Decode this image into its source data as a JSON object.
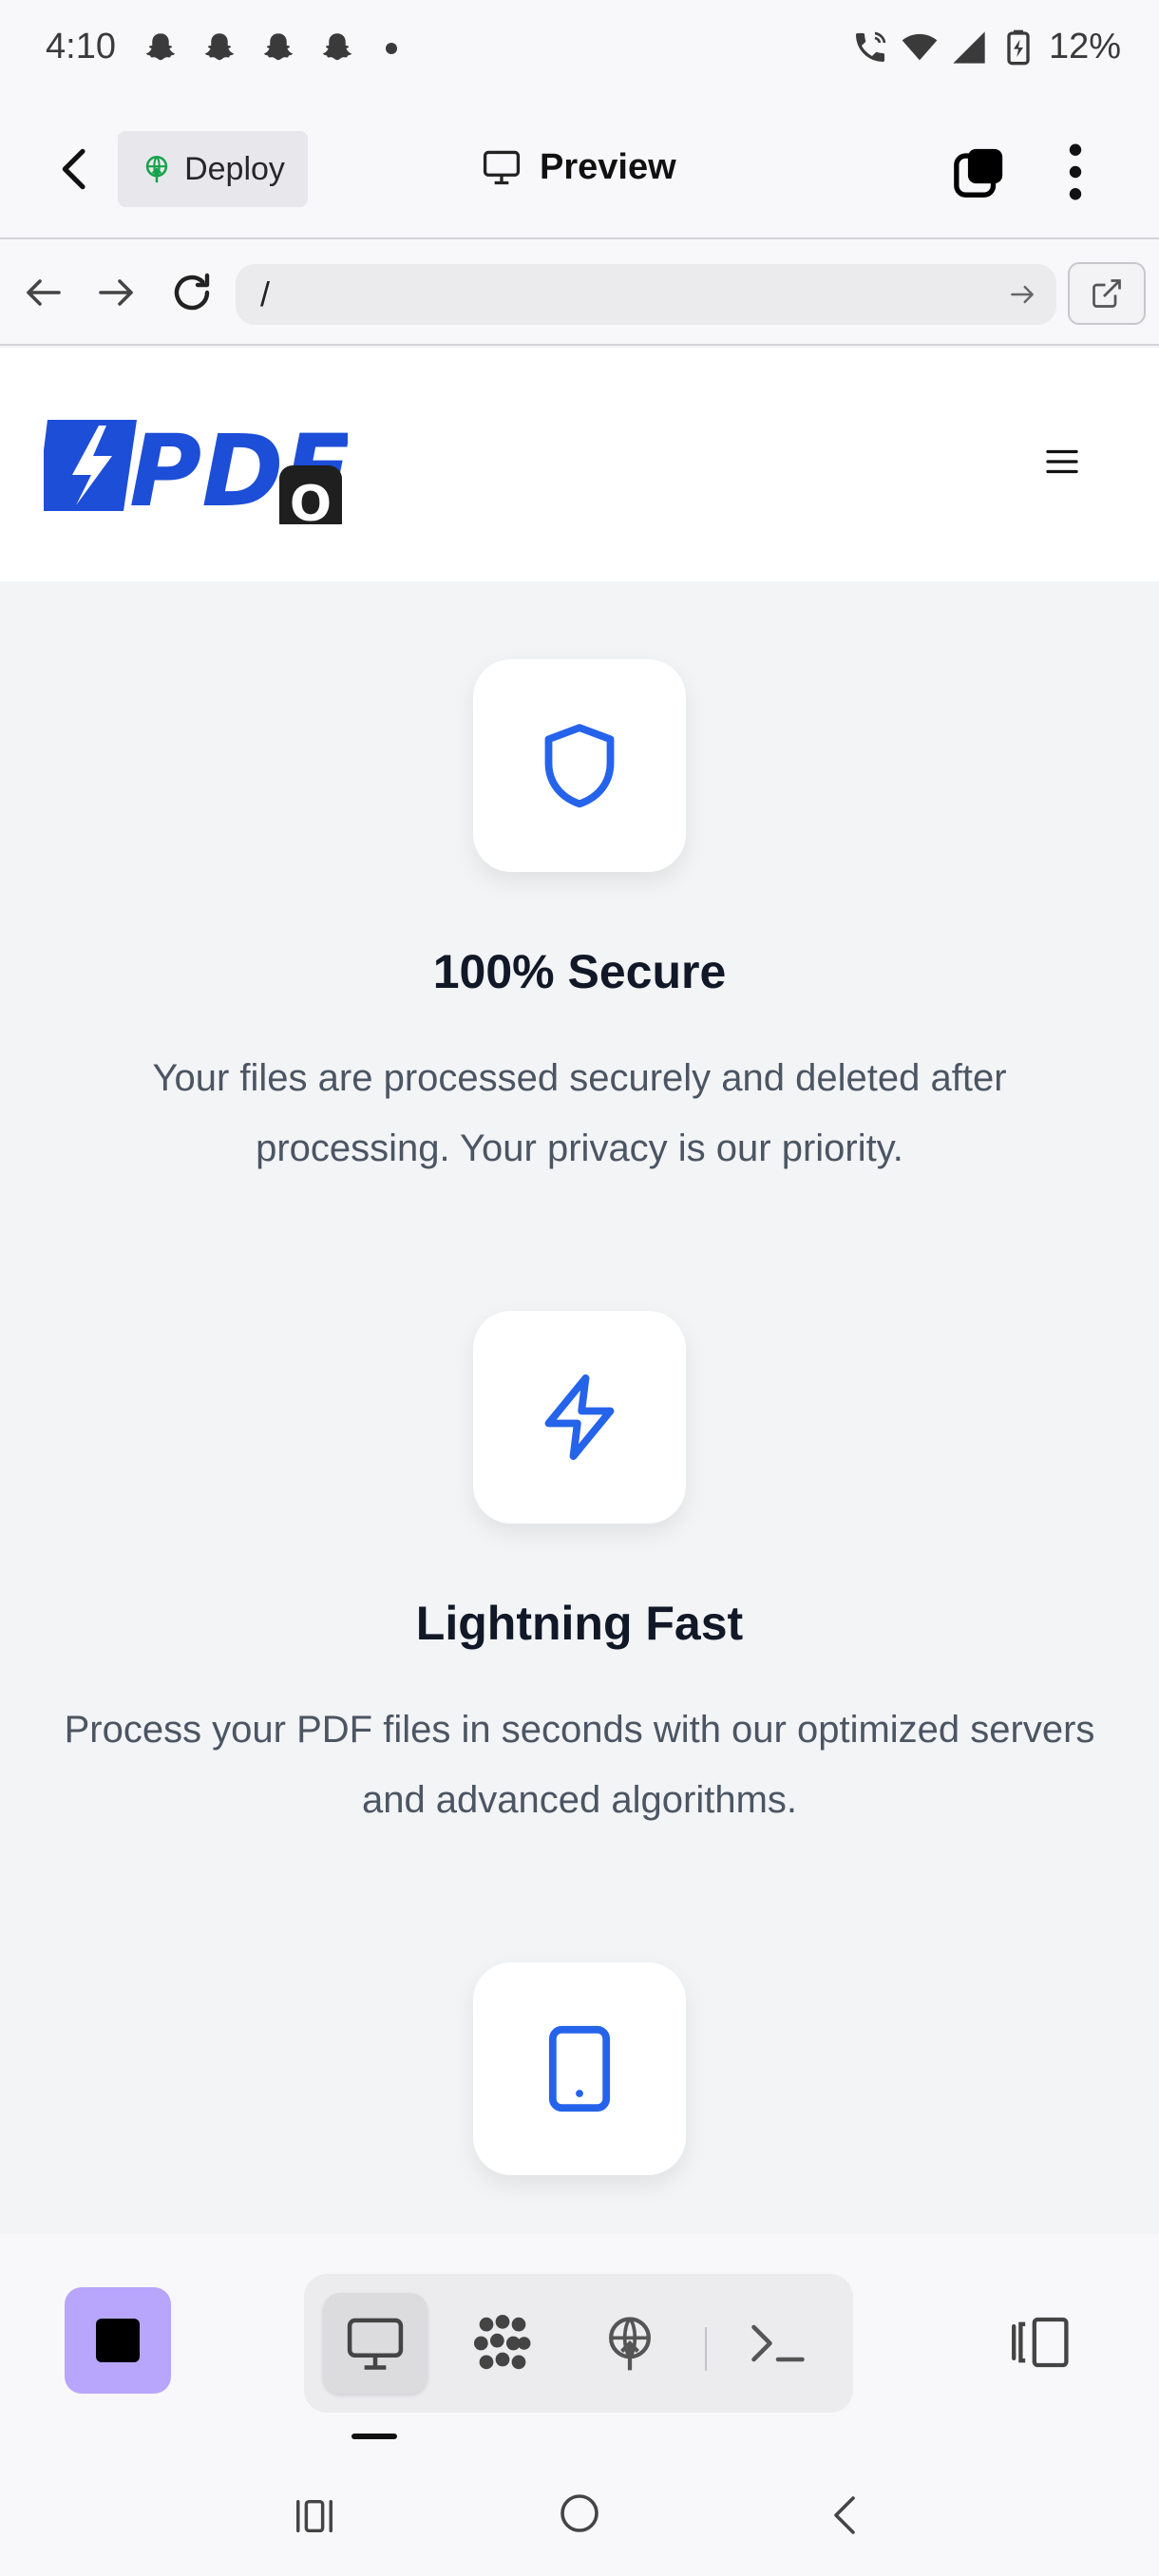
{
  "status_bar": {
    "time": "4:10",
    "battery": "12%",
    "notification_icons": [
      "snapchat-icon",
      "snapchat-icon",
      "snapchat-icon",
      "snapchat-icon"
    ]
  },
  "app_bar": {
    "deploy_label": "Deploy",
    "title": "Preview"
  },
  "browser": {
    "url": "/"
  },
  "site": {
    "logo_text": "PDF",
    "logo_badge": "O"
  },
  "features": [
    {
      "icon": "shield-icon",
      "title": "100% Secure",
      "description": "Your files are processed securely and deleted after processing. Your privacy is our priority."
    },
    {
      "icon": "lightning-icon",
      "title": "Lightning Fast",
      "description": "Process your PDF files in seconds with our optimized servers and advanced algorithms."
    },
    {
      "icon": "tablet-icon",
      "title": "",
      "description": ""
    }
  ],
  "colors": {
    "accent": "#2563eb",
    "stop_button": "#b7a6fb",
    "deploy_icon": "#16a34a"
  },
  "toolbar": {
    "tools": [
      "desktop-icon",
      "extensions-icon",
      "deploy-globe-icon",
      "terminal-icon"
    ],
    "active_tool": "desktop-icon"
  }
}
